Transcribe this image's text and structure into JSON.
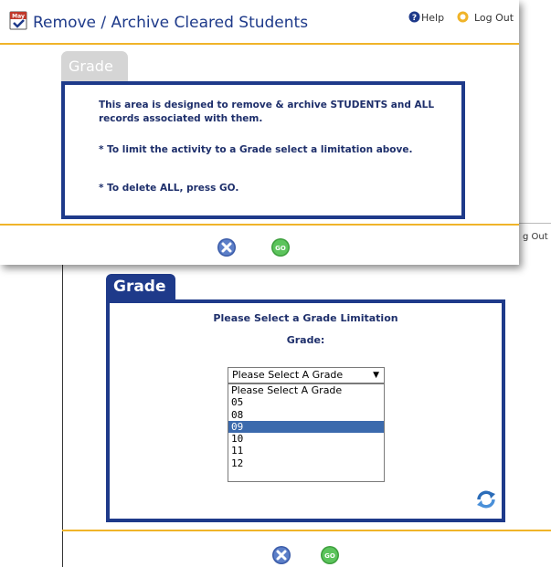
{
  "background_screen": {
    "header_logout_fragment": "g Out",
    "tab_label": "Grade",
    "heading": "Please Select a Grade Limitation",
    "field_label": "Grade:",
    "select": {
      "selected_value": "Please Select A Grade",
      "options": [
        "Please Select A Grade",
        "05",
        "08",
        "09",
        "10",
        "11",
        "12"
      ],
      "highlighted_option": "09"
    },
    "icons": [
      "refresh-icon",
      "cancel-icon",
      "go-icon"
    ],
    "go_label": "GO"
  },
  "window": {
    "title": "Remove / Archive Cleared Students",
    "calendar_icon_text": "May",
    "help_label": "Help",
    "logout_label": "Log Out",
    "tab_label": "Grade",
    "info": {
      "p1": "This area is designed to remove & archive STUDENTS and ALL records associated with them.",
      "p2": "* To limit the activity to a Grade select a limitation above.",
      "p3": "* To delete ALL, press GO."
    },
    "go_label": "GO"
  },
  "colors": {
    "navy": "#1e3a8a",
    "orange": "#f0b429",
    "tab_grey": "#d5d5d5",
    "highlight": "#3b6aad"
  }
}
